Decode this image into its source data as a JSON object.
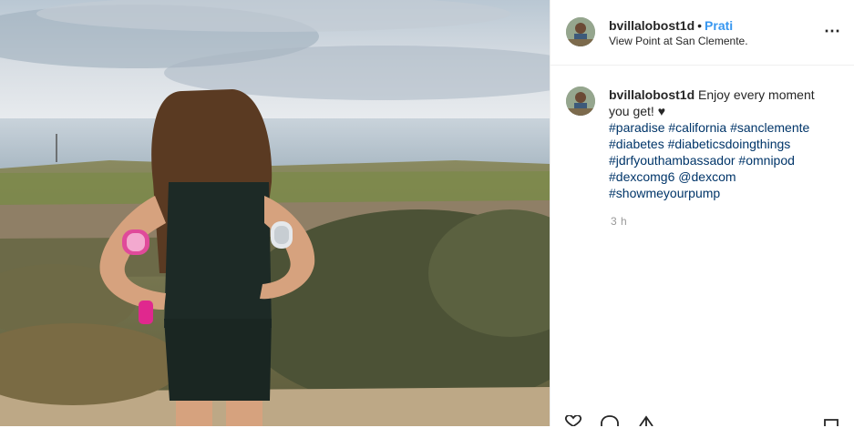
{
  "post": {
    "username": "bvillalobost1d",
    "follow_label": "Prati",
    "separator": "•",
    "location": "View Point at San Clemente.",
    "caption_text": "Enjoy every moment you get! ♥",
    "hashtags": [
      "#paradise",
      "#california",
      "#sanclemente",
      "#diabetes",
      "#diabeticsdoingthings",
      "#jdrfyouthambassador",
      "#omnipod",
      "#dexcomg6",
      "@dexcom",
      "#showmeyourpump"
    ],
    "time": "3 h",
    "more_icon": "⋯"
  },
  "icons": {
    "more": "more-options-icon",
    "like": "heart-icon",
    "comment": "comment-icon",
    "share": "share-icon",
    "save": "bookmark-icon"
  },
  "colors": {
    "follow": "#3897f0",
    "hashtag": "#003569",
    "meta": "#999999"
  }
}
